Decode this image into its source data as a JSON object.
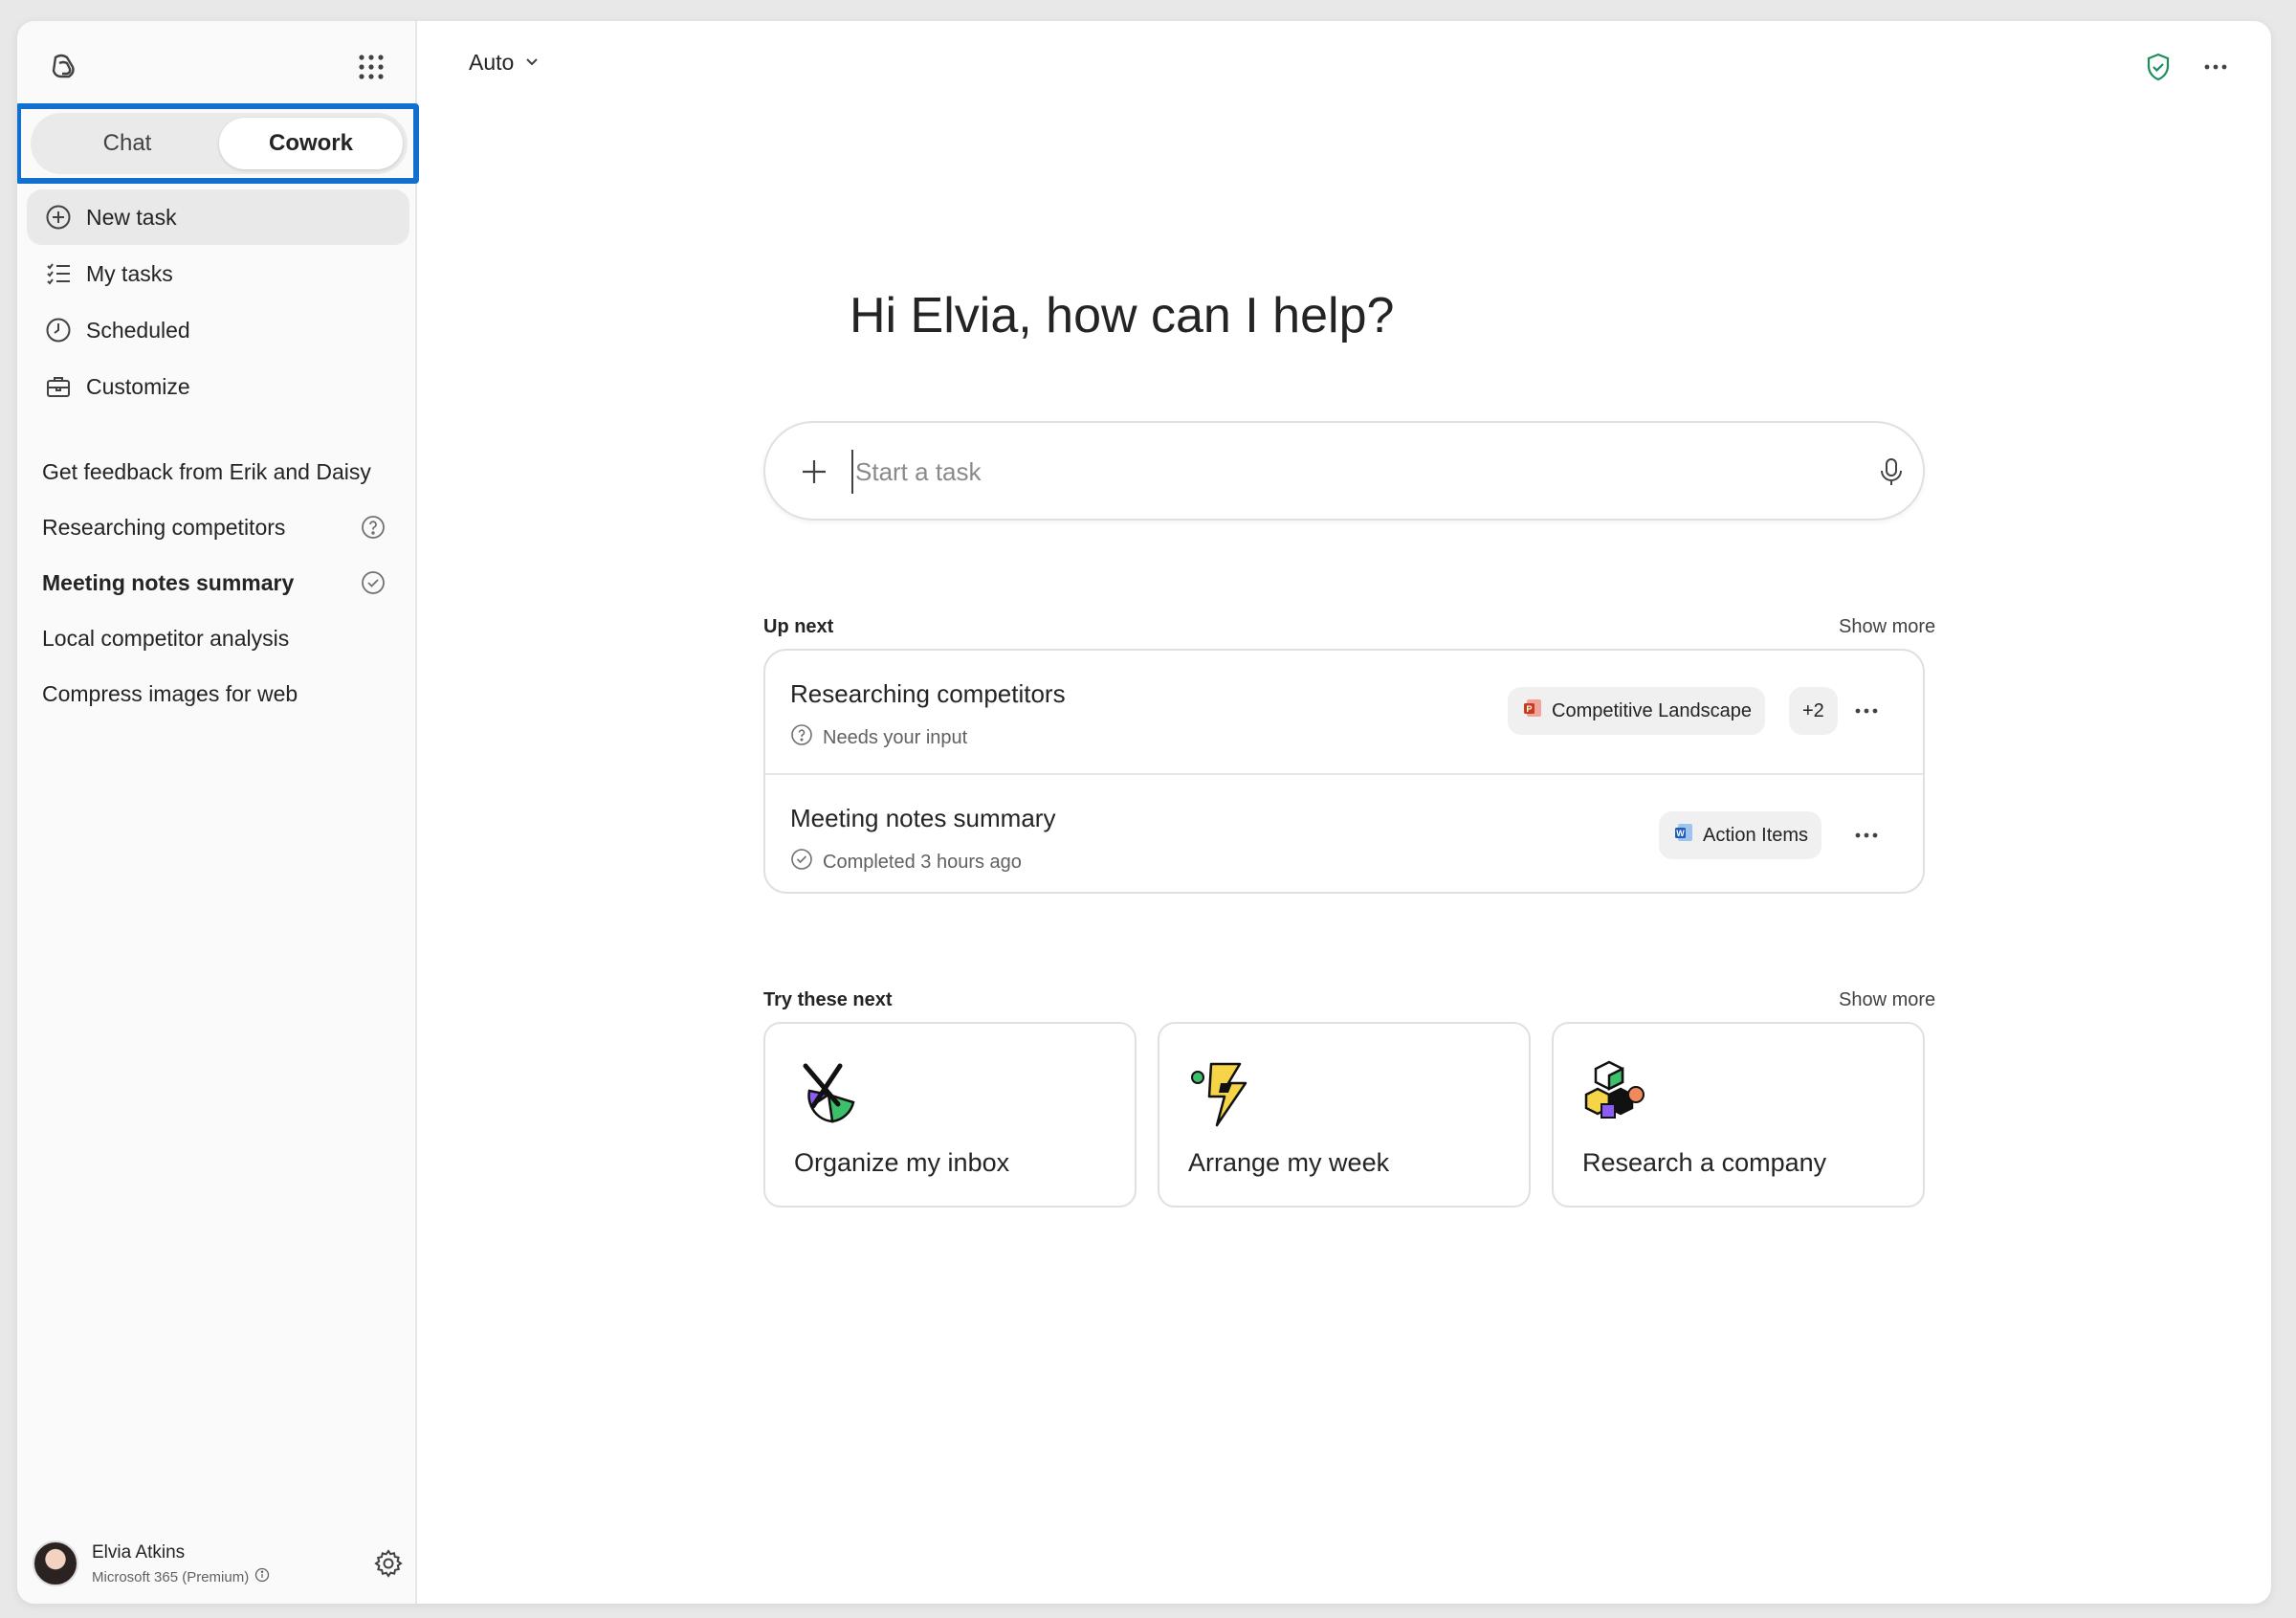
{
  "sidebar": {
    "modes": {
      "chat": "Chat",
      "cowork": "Cowork"
    },
    "nav": [
      {
        "label": "New task",
        "icon": "add-circle-icon"
      },
      {
        "label": "My tasks",
        "icon": "task-list-icon"
      },
      {
        "label": "Scheduled",
        "icon": "clock-icon"
      },
      {
        "label": "Customize",
        "icon": "briefcase-icon"
      }
    ],
    "recent": [
      {
        "label": "Get feedback from Erik and Daisy",
        "status": ""
      },
      {
        "label": "Researching competitors",
        "status": "question-icon"
      },
      {
        "label": "Meeting notes summary",
        "status": "check-circle-icon"
      },
      {
        "label": "Local competitor analysis",
        "status": ""
      },
      {
        "label": "Compress images for web",
        "status": ""
      }
    ],
    "profile": {
      "name": "Elvia Atkins",
      "plan": "Microsoft 365 (Premium)"
    }
  },
  "header": {
    "model": "Auto"
  },
  "main": {
    "greeting": "Hi Elvia, how can I help?",
    "composer": {
      "placeholder": "Start a task"
    },
    "up_next": {
      "title": "Up next",
      "show_more": "Show more",
      "tasks": [
        {
          "title": "Researching competitors",
          "status": "Needs your input",
          "chip": "Competitive Landscape",
          "extra": "+2"
        },
        {
          "title": "Meeting notes summary",
          "status": "Completed 3 hours ago",
          "chip": "Action Items"
        }
      ]
    },
    "try_next": {
      "title": "Try these next",
      "show_more": "Show more",
      "cards": [
        {
          "label": "Organize my inbox"
        },
        {
          "label": "Arrange my week"
        },
        {
          "label": "Research a company"
        }
      ]
    }
  },
  "colors": {
    "accent_highlight": "#1170cf",
    "shield_green": "#1a8f5a"
  }
}
